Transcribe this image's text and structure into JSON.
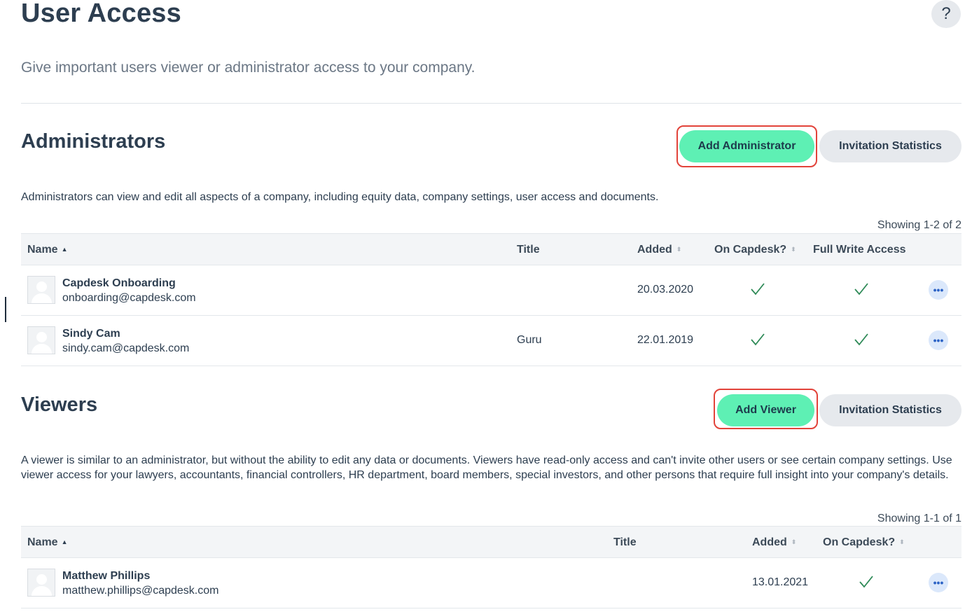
{
  "page": {
    "title": "User Access",
    "subtitle": "Give important users viewer or administrator access to your company.",
    "help_label": "?"
  },
  "administrators": {
    "title": "Administrators",
    "add_button": "Add Administrator",
    "stats_button": "Invitation Statistics",
    "description": "Administrators can view and edit all aspects of a company, including equity data, company settings, user access and documents.",
    "showing": "Showing 1-2 of 2",
    "columns": {
      "name": "Name",
      "title": "Title",
      "added": "Added",
      "on_capdesk": "On Capdesk?",
      "full_write": "Full Write Access"
    },
    "rows": [
      {
        "name": "Capdesk Onboarding",
        "email": "onboarding@capdesk.com",
        "title": "",
        "added": "20.03.2020",
        "on_capdesk": true,
        "full_write": true
      },
      {
        "name": "Sindy Cam",
        "email": "sindy.cam@capdesk.com",
        "title": "Guru",
        "added": "22.01.2019",
        "on_capdesk": true,
        "full_write": true
      }
    ]
  },
  "viewers": {
    "title": "Viewers",
    "add_button": "Add Viewer",
    "stats_button": "Invitation Statistics",
    "description": "A viewer is similar to an administrator, but without the ability to edit any data or documents. Viewers have read-only access and can't invite other users or see certain company settings. Use viewer access for your lawyers, accountants, financial controllers, HR department, board members, special investors, and other persons that require full insight into your company's details.",
    "showing": "Showing 1-1 of 1",
    "columns": {
      "name": "Name",
      "title": "Title",
      "added": "Added",
      "on_capdesk": "On Capdesk?"
    },
    "rows": [
      {
        "name": "Matthew Phillips",
        "email": "matthew.phillips@capdesk.com",
        "title": "",
        "added": "13.01.2021",
        "on_capdesk": true
      }
    ]
  },
  "colors": {
    "primary_button": "#5ef0b4",
    "highlight_border": "#e2433a",
    "check_color": "#2e8a57",
    "more_button": "#dbe8fb"
  },
  "icons": {
    "help": "question-mark",
    "check": "checkmark",
    "more": "ellipsis",
    "avatar": "user-placeholder",
    "sort": "sort-arrows"
  }
}
